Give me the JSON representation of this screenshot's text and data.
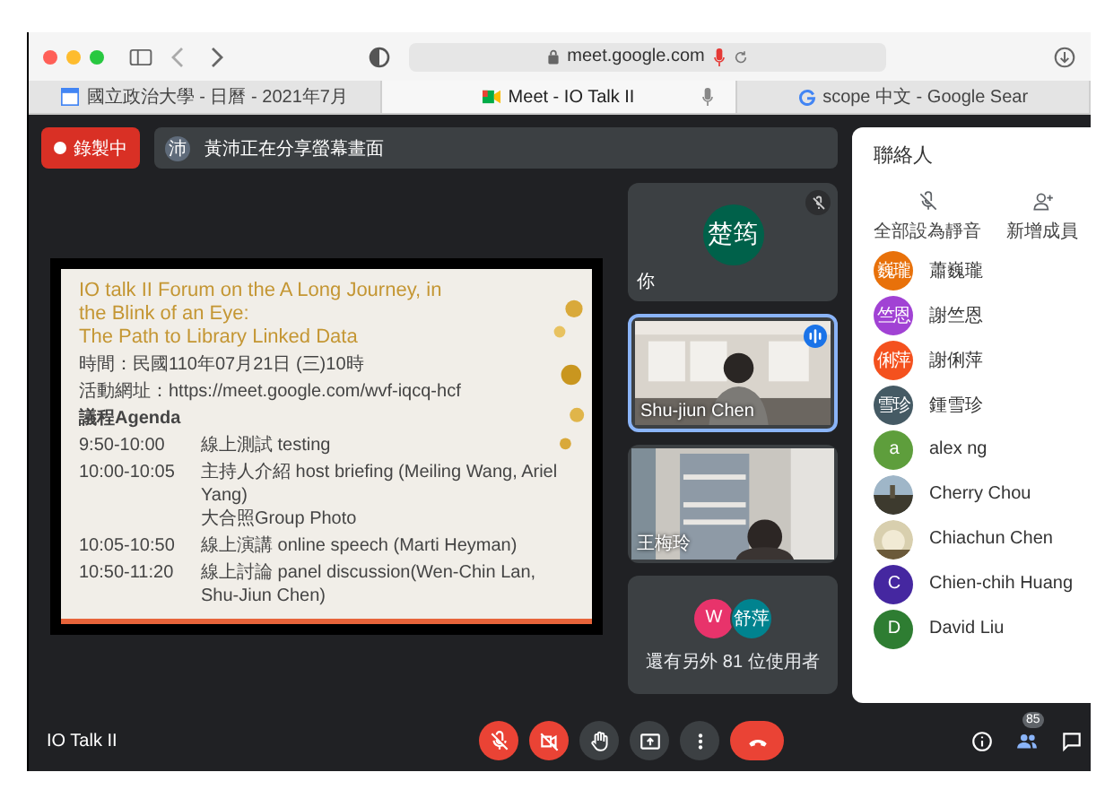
{
  "browser": {
    "url": "meet.google.com",
    "tabs": [
      {
        "title": "國立政治大學 - 日曆 - 2021年7月",
        "selected": false
      },
      {
        "title": "Meet - IO Talk II",
        "selected": true
      },
      {
        "title": "scope 中文 - Google Sear",
        "selected": false
      }
    ]
  },
  "meeting": {
    "recording_label": "錄製中",
    "presenter_initial": "沛",
    "presenting_notice": "黃沛正在分享螢幕畫面",
    "title": "IO Talk II"
  },
  "slide": {
    "title_lines": [
      "IO talk II Forum on the A Long Journey, in",
      "the Blink of an Eye:",
      "The Path to Library Linked Data"
    ],
    "meta": [
      "時間：民國110年07月21日 (三)10時",
      "活動網址：https://meet.google.com/wvf-iqcq-hcf"
    ],
    "agenda_heading": "議程Agenda",
    "agenda": [
      {
        "time": "9:50-10:00",
        "items": [
          "線上測試 testing"
        ]
      },
      {
        "time": "10:00-10:05",
        "items": [
          "主持人介紹 host briefing (Meiling Wang, Ariel Yang)",
          "大合照Group Photo"
        ]
      },
      {
        "time": "10:05-10:50",
        "items": [
          "線上演講 online speech (Marti Heyman)"
        ]
      },
      {
        "time": "10:50-11:20",
        "items": [
          "線上討論 panel discussion(Wen-Chin Lan, Shu-Jiun Chen)"
        ]
      }
    ]
  },
  "tiles": [
    {
      "kind": "avatar",
      "initials": "楚筠",
      "color": "#00614a",
      "name": "你",
      "mic_muted": true,
      "speaking": false
    },
    {
      "kind": "video",
      "name": "Shu-jiun Chen",
      "mic_muted": false,
      "speaking": true
    },
    {
      "kind": "video",
      "name": "王梅玲",
      "mic_muted": false,
      "speaking": false
    },
    {
      "kind": "more",
      "avatars": [
        {
          "initials": "W",
          "color": "#e8336b"
        },
        {
          "initials": "舒萍",
          "color": "#00838f"
        }
      ],
      "label": "還有另外 81 位使用者"
    }
  ],
  "people": {
    "title": "聯絡人",
    "actions": [
      {
        "kind": "mute",
        "label": "全部設為靜音"
      },
      {
        "kind": "add",
        "label": "新增成員"
      }
    ],
    "list": [
      {
        "kind": "initials",
        "initials": "巍瓏",
        "color": "#e8710a",
        "name": "蕭巍瓏"
      },
      {
        "kind": "initials",
        "initials": "竺恩",
        "color": "#a142d4",
        "name": "謝竺恩"
      },
      {
        "kind": "initials",
        "initials": "俐萍",
        "color": "#f4511e",
        "name": "謝俐萍"
      },
      {
        "kind": "initials",
        "initials": "雪珍",
        "color": "#455a64",
        "name": "鍾雪珍"
      },
      {
        "kind": "initials",
        "initials": "a",
        "color": "#5e9e3c",
        "name": "alex ng"
      },
      {
        "name": "Cherry Chou"
      },
      {
        "name": "Chiachun Chen"
      },
      {
        "kind": "initials",
        "initials": "C",
        "color": "#4527a0",
        "name": "Chien-chih Huang"
      },
      {
        "kind": "initials",
        "initials": "D",
        "color": "#2e7d32",
        "name": "David Liu"
      }
    ]
  },
  "controls": [
    {
      "kind": "mic",
      "on": false
    },
    {
      "kind": "camera",
      "on": false
    },
    {
      "kind": "hand"
    },
    {
      "kind": "present"
    },
    {
      "kind": "more"
    },
    {
      "kind": "leave"
    }
  ],
  "participant_count": "85"
}
